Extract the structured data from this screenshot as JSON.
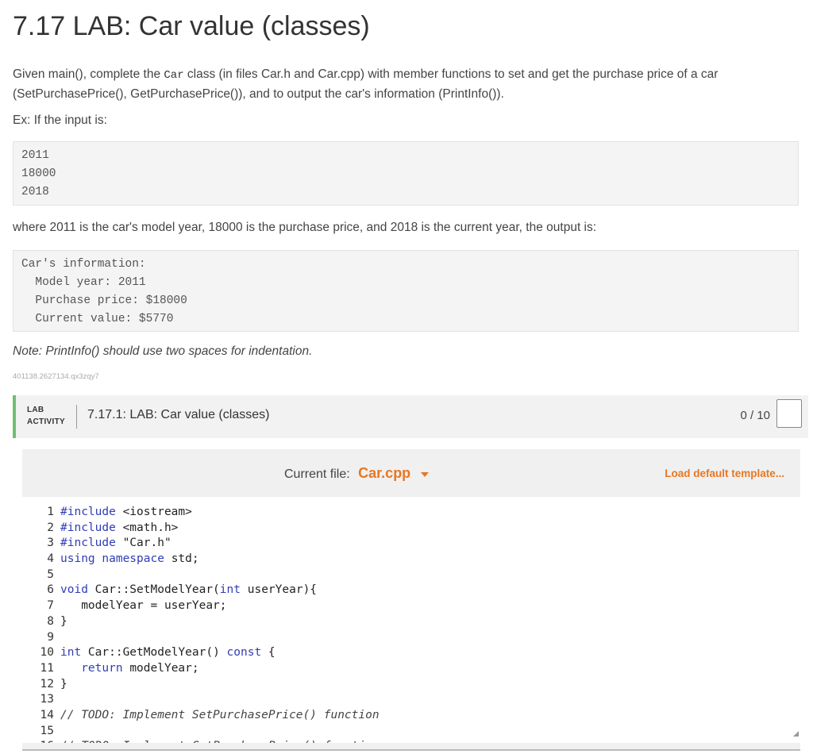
{
  "page": {
    "title": "7.17 LAB: Car value (classes)",
    "intro_pre": "Given main(), complete the ",
    "intro_code": "Car",
    "intro_post": " class (in files Car.h and Car.cpp) with member functions to set and get the purchase price of a car (SetPurchasePrice(), GetPurchasePrice()), and to output the car's information (PrintInfo()).",
    "example_label": "Ex: If the input is:",
    "input_example": [
      "2011",
      "18000",
      "2018"
    ],
    "where_text": "where 2011 is the car's model year, 18000 is the purchase price, and 2018 is the current year, the output is:",
    "output_example": [
      "Car's information:",
      "  Model year: 2011",
      "  Purchase price: $18000",
      "  Current value: $5770"
    ],
    "note": "Note: PrintInfo() should use two spaces for indentation.",
    "id_text": "401138.2627134.qx3zqy7"
  },
  "lab": {
    "label_line1": "LAB",
    "label_line2": "ACTIVITY",
    "title": "7.17.1: LAB: Car value (classes)",
    "score": "0 / 10"
  },
  "editor": {
    "current_file_label": "Current file:",
    "current_file": "Car.cpp",
    "load_template": "Load default template...",
    "code_lines": [
      "#include <iostream>",
      "#include <math.h>",
      "#include \"Car.h\"",
      "using namespace std;",
      "",
      "void Car::SetModelYear(int userYear){",
      "   modelYear = userYear;",
      "}",
      "",
      "int Car::GetModelYear() const {",
      "   return modelYear;",
      "}",
      "",
      "// TODO: Implement SetPurchasePrice() function",
      "",
      "// TODO: Implement GetPurchasePrice() function"
    ]
  },
  "colors": {
    "accent": "#e87722",
    "lab_stripe": "#6fbf73",
    "keyword": "#2f3db6"
  }
}
